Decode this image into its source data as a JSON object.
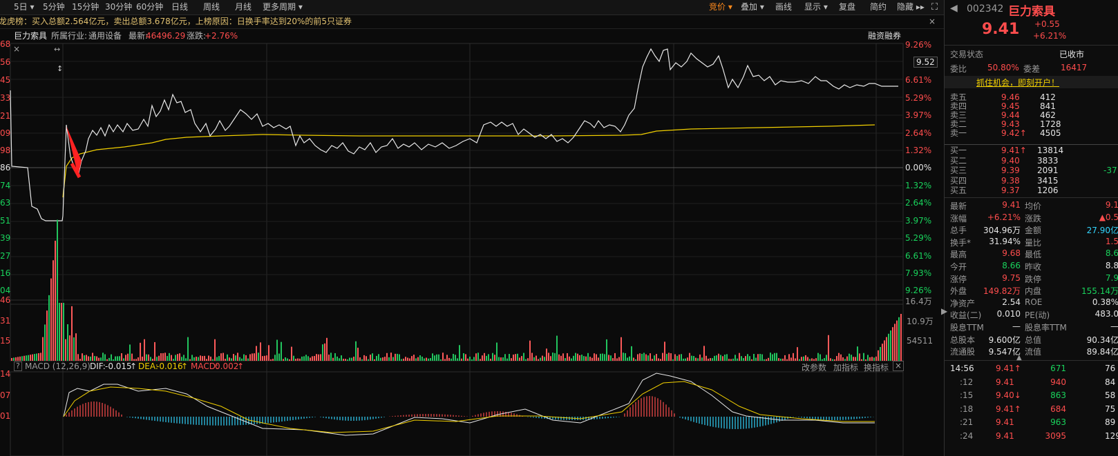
{
  "toolbar": {
    "left_tabs": [
      "5日",
      "5分钟",
      "15分钟",
      "30分钟",
      "60分钟",
      "日线",
      "周线",
      "月线",
      "更多周期"
    ],
    "right_tabs": [
      "竞价",
      "叠加",
      "画线",
      "显示",
      "复盘",
      "简约",
      "隐藏"
    ]
  },
  "info_bar": {
    "text": "龙虎榜：买入总额2.564亿元，卖出总额3.678亿元，上榜原因：日换手率达到20%的前5只证券",
    "close": "×"
  },
  "chart_header": {
    "name": "巨力索具",
    "industry_label": "所属行业:",
    "industry": "通用设备",
    "latest_label": "最新:",
    "latest": "46496.29",
    "change_label": "涨跌:",
    "change": "+2.76%",
    "margin_trading": "融资融券"
  },
  "price_axis": {
    "left": [
      "68",
      "56",
      "45",
      "33",
      "21",
      "09",
      "98",
      "86",
      "74",
      "63",
      "51",
      "39",
      "27",
      "16",
      "04"
    ],
    "right": [
      "9.26%",
      "7.93%",
      "6.61%",
      "5.29%",
      "3.97%",
      "2.64%",
      "1.32%",
      "0.00%",
      "1.32%",
      "2.64%",
      "3.97%",
      "5.29%",
      "6.61%",
      "7.93%",
      "9.26%"
    ],
    "current": "9.52"
  },
  "volume_axis": {
    "left": [
      "46",
      "31",
      "15"
    ],
    "right": [
      "16.4万",
      "10.9万",
      "54511"
    ]
  },
  "macd_bar": {
    "title": "MACD (12,26,9)",
    "dif_label": "DIF:",
    "dif": "-0.015",
    "dea_label": "DEA:",
    "dea": "-0.016",
    "macd_label": "MACD:",
    "macd": "0.002",
    "actions": [
      "改参数",
      "加指标",
      "换指标"
    ],
    "left_axis": [
      "14",
      "07",
      "01"
    ]
  },
  "colors": {
    "up": "#ff4d4d",
    "down": "#19d35c",
    "avg_line": "#f2d000",
    "active_tab": "#ff8a1c"
  },
  "quote": {
    "code": "002342",
    "name": "巨力索具",
    "price": "9.41",
    "change": "+0.55",
    "change_pct": "+6.21%",
    "status_label": "交易状态",
    "status": "已收市",
    "wb_label": "委比",
    "wb": "50.80%",
    "wc_label": "委差",
    "wc": "16417",
    "banner": "抓住机会，即刻开户！",
    "asks": [
      {
        "label": "卖五",
        "price": "9.46",
        "vol": "412"
      },
      {
        "label": "卖四",
        "price": "9.45",
        "vol": "841"
      },
      {
        "label": "卖三",
        "price": "9.44",
        "vol": "462"
      },
      {
        "label": "卖二",
        "price": "9.43",
        "vol": "1728"
      },
      {
        "label": "卖一",
        "price": "9.42↑",
        "vol": "4505"
      }
    ],
    "bids": [
      {
        "label": "买一",
        "price": "9.41↑",
        "vol": "13814",
        "extra": ""
      },
      {
        "label": "买二",
        "price": "9.40",
        "vol": "3833",
        "extra": ""
      },
      {
        "label": "买三",
        "price": "9.39",
        "vol": "2091",
        "extra": "-37"
      },
      {
        "label": "买四",
        "price": "9.38",
        "vol": "3415",
        "extra": ""
      },
      {
        "label": "买五",
        "price": "9.37",
        "vol": "1206",
        "extra": ""
      }
    ],
    "stats": [
      {
        "l1": "最新",
        "v1": "9.41",
        "c1": "red",
        "l2": "均价",
        "v2": "9.1",
        "c2": "red"
      },
      {
        "l1": "涨幅",
        "v1": "+6.21%",
        "c1": "red",
        "l2": "涨跌",
        "v2": "▲0.5",
        "c2": "red"
      },
      {
        "l1": "总手",
        "v1": "304.96万",
        "c1": "wht",
        "l2": "金额",
        "v2": "27.90亿",
        "c2": "cyan"
      },
      {
        "l1": "换手*",
        "v1": "31.94%",
        "c1": "wht",
        "l2": "量比",
        "v2": "1.5",
        "c2": "red"
      },
      {
        "l1": "最高",
        "v1": "9.68",
        "c1": "red",
        "l2": "最低",
        "v2": "8.6",
        "c2": "green"
      },
      {
        "l1": "今开",
        "v1": "8.66",
        "c1": "green",
        "l2": "昨收",
        "v2": "8.8",
        "c2": "wht"
      },
      {
        "l1": "涨停",
        "v1": "9.75",
        "c1": "red",
        "l2": "跌停",
        "v2": "7.9",
        "c2": "green"
      },
      {
        "l1": "外盘",
        "v1": "149.82万",
        "c1": "red",
        "l2": "内盘",
        "v2": "155.14万",
        "c2": "green"
      },
      {
        "l1": "净资产",
        "v1": "2.54",
        "c1": "wht",
        "l2": "ROE",
        "v2": "0.38%",
        "c2": "wht"
      },
      {
        "l1": "收益(二)",
        "v1": "0.010",
        "c1": "wht",
        "l2": "PE(动)",
        "v2": "483.0",
        "c2": "wht"
      },
      {
        "l1": "股息TTM",
        "v1": "—",
        "c1": "wht",
        "l2": "股息率TTM",
        "v2": "—",
        "c2": "wht"
      },
      {
        "l1": "总股本",
        "v1": "9.600亿",
        "c1": "wht",
        "l2": "总值",
        "v2": "90.34亿",
        "c2": "wht"
      },
      {
        "l1": "流通股",
        "v1": "9.547亿",
        "c1": "wht",
        "l2": "流值",
        "v2": "89.84亿",
        "c2": "wht"
      }
    ],
    "ticks": [
      {
        "time": "14:56",
        "price": "9.41↑",
        "vol": "671",
        "extra": "76"
      },
      {
        "time": ":12",
        "price": "9.41",
        "vol": "940",
        "extra": "84"
      },
      {
        "time": ":15",
        "price": "9.40↓",
        "vol": "863",
        "extra": "58"
      },
      {
        "time": ":18",
        "price": "9.41↑",
        "vol": "684",
        "extra": "75"
      },
      {
        "time": ":21",
        "price": "9.41",
        "vol": "963",
        "extra": "89"
      },
      {
        "time": ":24",
        "price": "9.41",
        "vol": "3095",
        "extra": "129"
      }
    ]
  }
}
